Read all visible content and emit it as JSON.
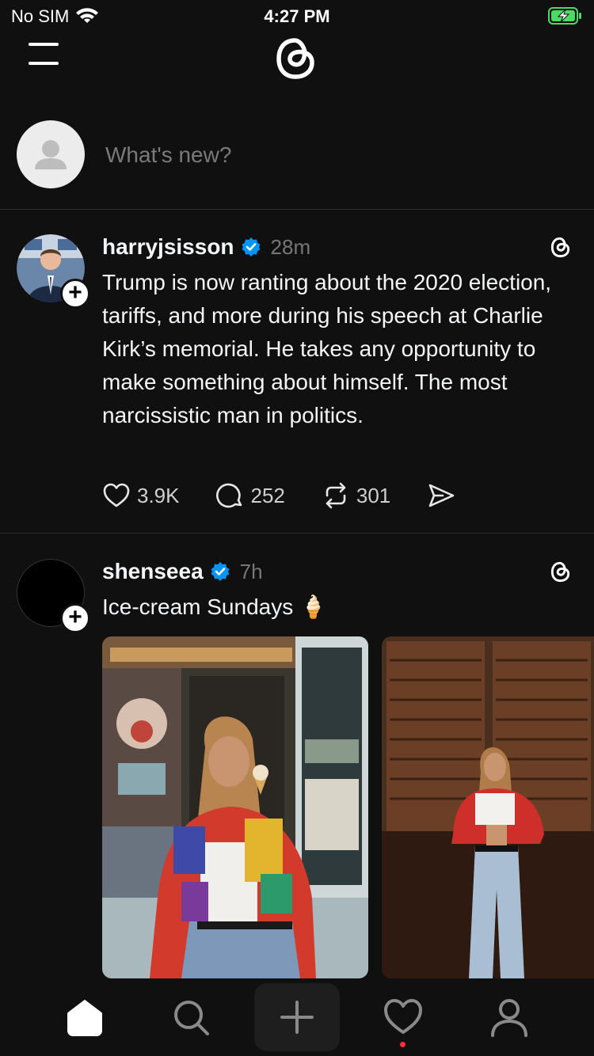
{
  "status_bar": {
    "carrier": "No SIM",
    "time": "4:27 PM"
  },
  "composer": {
    "placeholder": "What's new?"
  },
  "feed": [
    {
      "username": "harryjsisson",
      "verified": true,
      "time": "28m",
      "text": "Trump is now ranting about the 2020 election, tariffs, and more during his speech at Charlie Kirk’s memorial. He takes any opportunity to make something about himself. The most narcissistic man in politics.",
      "likes": "3.9K",
      "replies": "252",
      "reposts": "301"
    },
    {
      "username": "shenseea",
      "verified": true,
      "time": "7h",
      "text": "Ice-cream Sundays 🍦",
      "images": [
        "photo-ice-cream-shop",
        "photo-wooden-shutters"
      ]
    }
  ],
  "colors": {
    "background": "#101010",
    "verified": "#0095f6",
    "notification": "#ff3040"
  },
  "icons": {
    "menu": "menu-icon",
    "logo": "threads-logo-icon",
    "like": "heart-icon",
    "reply": "comment-icon",
    "repost": "repost-icon",
    "share": "send-icon",
    "home": "home-icon",
    "search": "search-icon",
    "create": "plus-icon",
    "activity": "heart-icon",
    "profile": "profile-icon"
  }
}
